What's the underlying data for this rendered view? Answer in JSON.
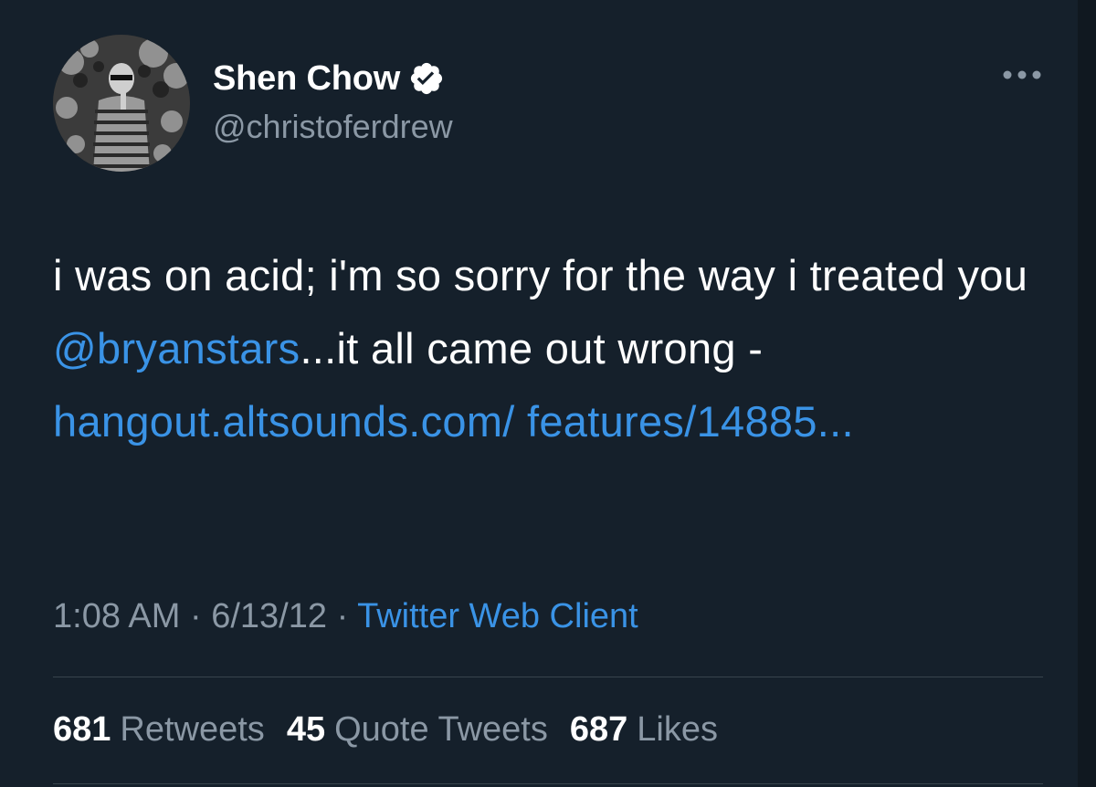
{
  "author": {
    "display_name": "Shen Chow",
    "handle": "@christoferdrew",
    "verified": true
  },
  "tweet": {
    "text_segments": {
      "s1": "i was on acid; i'm so sorry for the way i treated you ",
      "mention": "@bryanstars",
      "s2": "...it all came out wrong - ",
      "link": "hangout.altsounds.com/ features/14885..."
    },
    "time": "1:08 AM",
    "date": "6/13/12",
    "separator": "·",
    "source": "Twitter Web Client"
  },
  "stats": {
    "retweets": {
      "count": "681",
      "label": "Retweets"
    },
    "quotes": {
      "count": "45",
      "label": "Quote Tweets"
    },
    "likes": {
      "count": "687",
      "label": "Likes"
    }
  },
  "icons": {
    "verified": "verified-badge-icon",
    "more": "more-options-icon"
  },
  "colors": {
    "background": "#15202b",
    "link": "#3a93e6",
    "secondary_text": "#8b98a5",
    "primary_text": "#ffffff"
  }
}
